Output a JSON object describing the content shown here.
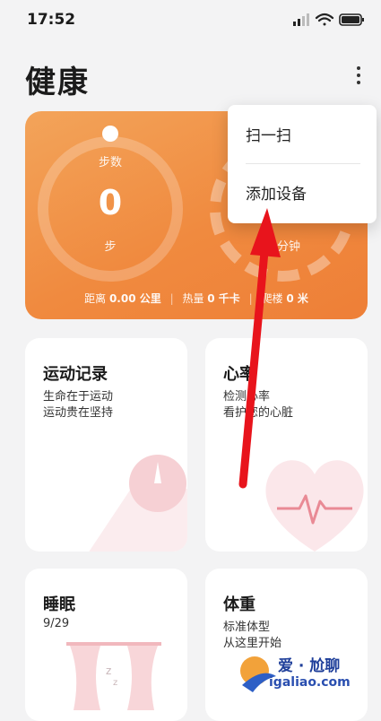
{
  "status_bar": {
    "time": "17:52"
  },
  "header": {
    "title": "健康"
  },
  "steps_card": {
    "steps_label": "步数",
    "steps_value": "0",
    "steps_unit": "步",
    "minutes_unit": "分钟",
    "distance_label": "距离",
    "distance_value": "0.00 公里",
    "calories_label": "热量",
    "calories_value": "0 千卡",
    "floors_label": "爬楼",
    "floors_value": "0 米"
  },
  "menu": {
    "items": [
      {
        "label": "扫一扫"
      },
      {
        "label": "添加设备"
      }
    ]
  },
  "cards": [
    {
      "title": "运动记录",
      "line1": "生命在于运动",
      "line2": "运动贵在坚持"
    },
    {
      "title": "心率",
      "line1": "检测心率",
      "line2": "看护您的心脏"
    },
    {
      "title": "睡眠",
      "line1": "9/29",
      "line2": ""
    },
    {
      "title": "体重",
      "line1": "标准体型",
      "line2": "从这里开始"
    }
  ],
  "watermark": {
    "line1": "爱 · 尬聊",
    "line2": "igaliao.com"
  },
  "colors": {
    "card_orange": "#f08a3f",
    "arrow_red": "#e8141c",
    "menu_bg": "#ffffff"
  }
}
